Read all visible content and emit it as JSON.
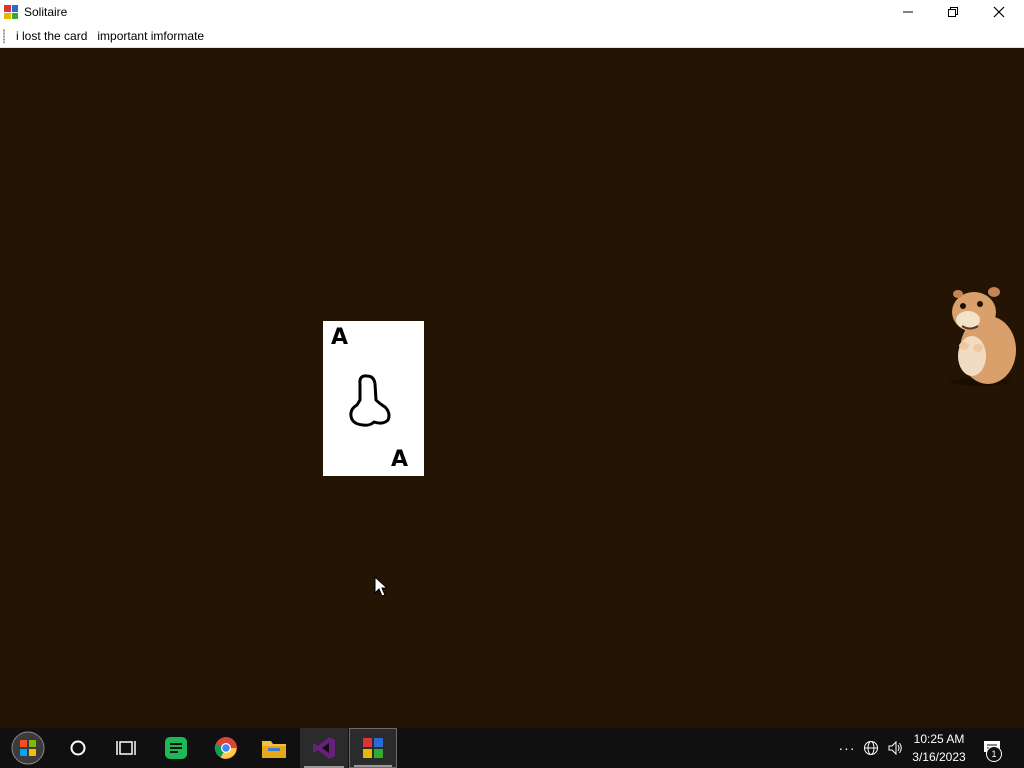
{
  "window": {
    "title": "Solitaire"
  },
  "menu": {
    "items": [
      "i lost the card",
      "important imformate"
    ]
  },
  "card": {
    "rank_top": "A",
    "rank_bottom": "A"
  },
  "taskbar": {
    "apps": [
      "start-icon",
      "cortana-icon",
      "task-view-icon",
      "notes-app-icon",
      "chrome-icon",
      "file-explorer-icon",
      "visual-studio-icon",
      "solitaire-app-icon"
    ],
    "clock_time": "10:25 AM",
    "clock_date": "3/16/2023",
    "notification_count": "1"
  },
  "colors": {
    "table": "#241404",
    "taskbar": "#101010",
    "vs_purple": "#68217a",
    "notes_green": "#1db954"
  }
}
